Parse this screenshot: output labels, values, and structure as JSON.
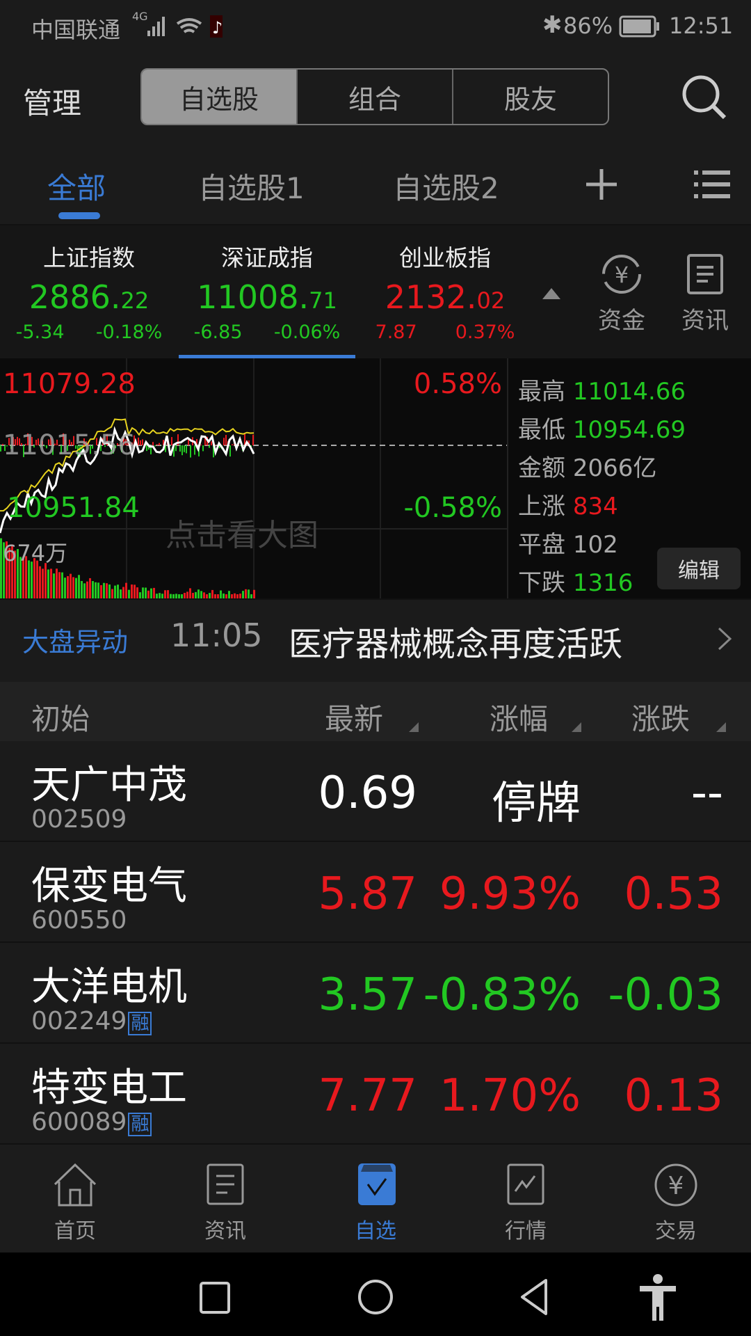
{
  "status_bar": {
    "carrier": "中国联通",
    "network": "4G",
    "battery": "86%",
    "time": "12:51"
  },
  "header": {
    "manage": "管理",
    "segments": [
      "自选股",
      "组合",
      "股友"
    ],
    "active_segment": 0
  },
  "tabs": {
    "items": [
      "全部",
      "自选股1",
      "自选股2"
    ],
    "active": 0
  },
  "indices": [
    {
      "name": "上证指数",
      "int": "2886.",
      "dec": "22",
      "chg": "-5.34",
      "pct": "-0.18%",
      "dir": "down"
    },
    {
      "name": "深证成指",
      "int": "11008.",
      "dec": "71",
      "chg": "-6.85",
      "pct": "-0.06%",
      "dir": "down"
    },
    {
      "name": "创业板指",
      "int": "2132.",
      "dec": "02",
      "chg": "7.87",
      "pct": "0.37%",
      "dir": "up"
    }
  ],
  "quick": {
    "funds": "资金",
    "news": "资讯"
  },
  "chart": {
    "high_label": "11079.28",
    "mid_label": "11015.56",
    "low_label": "10951.84",
    "high_pct": "0.58%",
    "low_pct": "-0.58%",
    "volume": "674万",
    "watermark": "点击看大图"
  },
  "stats": {
    "high_k": "最高",
    "high": "11014.66",
    "low_k": "最低",
    "low": "10954.69",
    "amount_k": "金额",
    "amount": "2066亿",
    "up_k": "上涨",
    "up": "834",
    "flat_k": "平盘",
    "flat": "102",
    "down_k": "下跌",
    "down": "1316",
    "edit": "编辑"
  },
  "news": {
    "label": "大盘异动",
    "time": "11:05",
    "headline": "医疗器械概念再度活跃"
  },
  "list": {
    "headers": [
      "初始",
      "最新",
      "涨幅",
      "涨跌"
    ],
    "rows": [
      {
        "name": "天广中茂",
        "code": "002509",
        "tag": "",
        "price": "0.69",
        "pct": "停牌",
        "chg": "--",
        "dir": "none"
      },
      {
        "name": "保变电气",
        "code": "600550",
        "tag": "",
        "price": "5.87",
        "pct": "9.93%",
        "chg": "0.53",
        "dir": "up"
      },
      {
        "name": "大洋电机",
        "code": "002249",
        "tag": "融",
        "price": "3.57",
        "pct": "-0.83%",
        "chg": "-0.03",
        "dir": "down"
      },
      {
        "name": "特变电工",
        "code": "600089",
        "tag": "融",
        "price": "7.77",
        "pct": "1.70%",
        "chg": "0.13",
        "dir": "up"
      }
    ]
  },
  "bottom_nav": {
    "items": [
      "首页",
      "资讯",
      "自选",
      "行情",
      "交易"
    ],
    "active": 2
  },
  "colors": {
    "up": "#e8191e",
    "down": "#22c822",
    "accent": "#3a7bd5"
  }
}
